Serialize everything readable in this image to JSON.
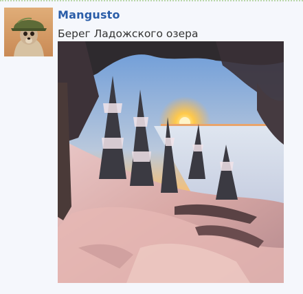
{
  "post": {
    "author": "Mangusto",
    "text": "Берег Ладожского озера",
    "avatar_icon": "meerkat-soldier-avatar-icon",
    "photo_icon": "winter-lake-photo"
  },
  "colors": {
    "background": "#f5f7fc",
    "author_link": "#2a5da8",
    "divider": "#b9d7a8"
  }
}
